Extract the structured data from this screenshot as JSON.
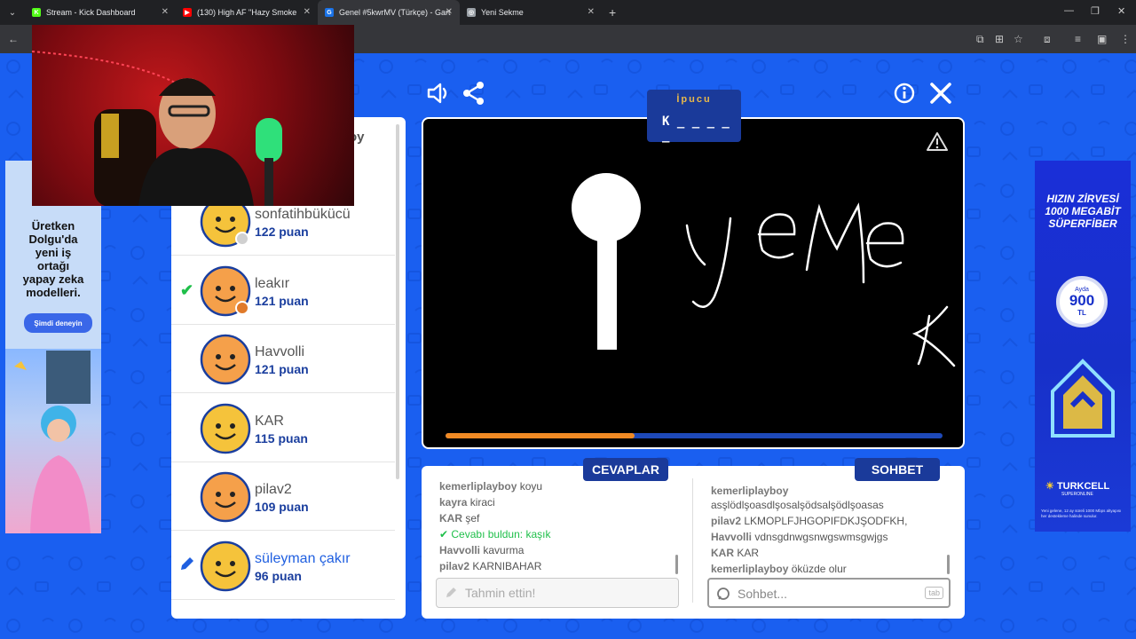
{
  "browser": {
    "tabs": [
      {
        "label": "Stream - Kick Dashboard",
        "color": "#53fc18",
        "glyph": "K",
        "active": false
      },
      {
        "label": "(130) High AF \"Hazy Smoke",
        "color": "#ff0000",
        "glyph": "▶",
        "active": false
      },
      {
        "label": "Genel #5kwrMV (Türkçe) - Gart",
        "color": "#1a73e8",
        "glyph": "G",
        "active": true
      },
      {
        "label": "Yeni Sekme",
        "color": "#9aa0a6",
        "glyph": "◎",
        "active": false
      }
    ],
    "tab_close": "✕",
    "new_tab": "+",
    "controls": {
      "minimize": "—",
      "restore": "❐",
      "close": "✕"
    }
  },
  "ad_left": {
    "cta": "Şimdi deneyin",
    "text_line1": "Üretken",
    "text_line2": "Dolgu'da",
    "text_line3": "yeni iş",
    "text_line4": "ortağı",
    "text_line5": "yapay zeka",
    "text_line6": "modelleri."
  },
  "ad_right": {
    "headline1": "HIZIN ZİRVESİ",
    "headline2": "1000 MEGABİT",
    "headline3": "SÜPERFİBER",
    "badge_top": "Ayda",
    "badge_value": "900",
    "badge_unit": "TL",
    "brand": "TURKCELL",
    "brand_sub": "SUPERONLINE",
    "fine": "Yeni gelene, 12 ay süreli 1000 Mbps altyapısı her destekleme halinde sunulur."
  },
  "players": [
    {
      "name": "sonfatihbükücü",
      "score": "122 puan",
      "guessed": false,
      "drawing": false,
      "avatar": "#f5c33b",
      "dot": "#d0d0d0"
    },
    {
      "name": "leakır",
      "score": "121 puan",
      "guessed": true,
      "drawing": false,
      "avatar": "#f5a04a",
      "dot": "#e07a2a"
    },
    {
      "name": "Havvolli",
      "score": "121 puan",
      "guessed": false,
      "drawing": false,
      "avatar": "#f5a04a",
      "dot": ""
    },
    {
      "name": "KAR",
      "score": "115 puan",
      "guessed": false,
      "drawing": false,
      "avatar": "#f5c33b",
      "dot": ""
    },
    {
      "name": "pilav2",
      "score": "109 puan",
      "guessed": false,
      "drawing": false,
      "avatar": "#f5a04a",
      "dot": ""
    },
    {
      "name": "süleyman çakır",
      "score": "96 puan",
      "guessed": false,
      "drawing": true,
      "avatar": "#f5c33b",
      "dot": ""
    }
  ],
  "player_top_partial": "oy",
  "hint": {
    "title": "İpucu",
    "word": "K _ _ _ _ _"
  },
  "drawing": {
    "text_label": "yemek",
    "progress": 0.38
  },
  "tags": {
    "answers": "CEVAPLAR",
    "chat": "SOHBET"
  },
  "answers": [
    {
      "user": "kemerliplayboy",
      "text": "koyu",
      "found": false
    },
    {
      "user": "kayra",
      "text": "kiraci",
      "found": false
    },
    {
      "user": "KAR",
      "text": "şef",
      "found": false
    },
    {
      "user": "",
      "text": "Cevabı buldun: kaşık",
      "found": true
    },
    {
      "user": "Havvolli",
      "text": "kavurma",
      "found": false
    },
    {
      "user": "pilav2",
      "text": "KARNIBAHAR",
      "found": false
    }
  ],
  "chat": [
    {
      "user": "kemerliplayboy",
      "text": "asşlödlşoasdlşosalşödsalşödlşoasas"
    },
    {
      "user": "pilav2",
      "text": "LKMOPLFJHGOPIFDKJŞODFKH,"
    },
    {
      "user": "Havvolli",
      "text": "vdnsgdnwgsnwgswmsgwjgs"
    },
    {
      "user": "KAR",
      "text": "KAR"
    },
    {
      "user": "kemerliplayboy",
      "text": "öküzde olur"
    }
  ],
  "inputs": {
    "guess_placeholder": "Tahmin ettin!",
    "chat_placeholder": "Sohbet...",
    "tab_key": "tab"
  }
}
